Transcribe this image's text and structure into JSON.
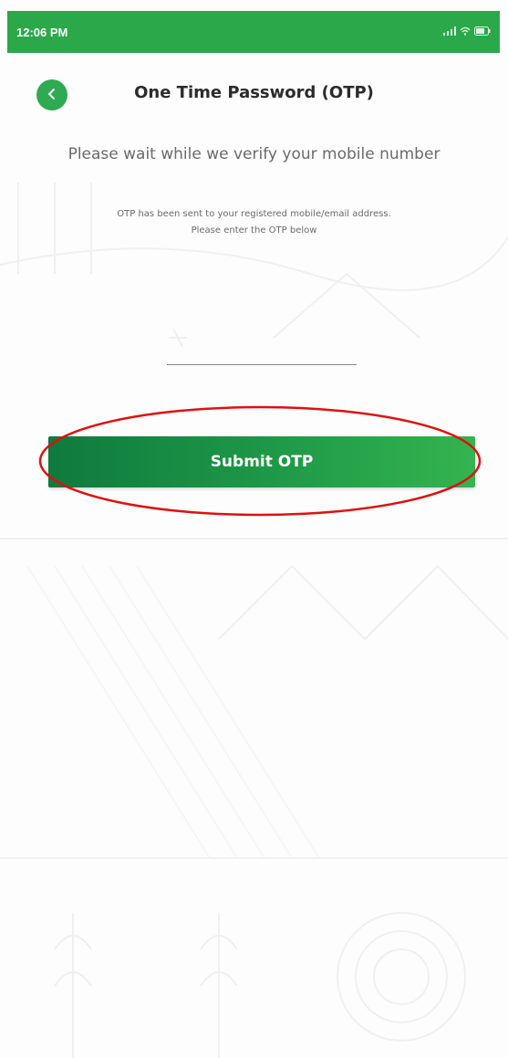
{
  "status_bar": {
    "time": "12:06 PM",
    "signal_icon": "signal-icon",
    "wifi_icon": "wifi-icon",
    "battery_icon": "battery-icon"
  },
  "header": {
    "back_icon": "chevron-left-icon",
    "title": "One Time Password (OTP)"
  },
  "body": {
    "verify_message": "Please wait while we verify your mobile number",
    "otp_info_line1": "OTP has been sent to your registered mobile/email address.",
    "otp_info_line2": "Please enter the OTP below"
  },
  "otp_input": {
    "value": "",
    "placeholder": ""
  },
  "submit": {
    "label": "Submit OTP"
  },
  "colors": {
    "status_bar": "#2aa84a",
    "back_button": "#2eaa52",
    "button_gradient_start": "#0f7a3e",
    "button_gradient_end": "#34b44f",
    "highlight_ellipse": "#e01010"
  }
}
